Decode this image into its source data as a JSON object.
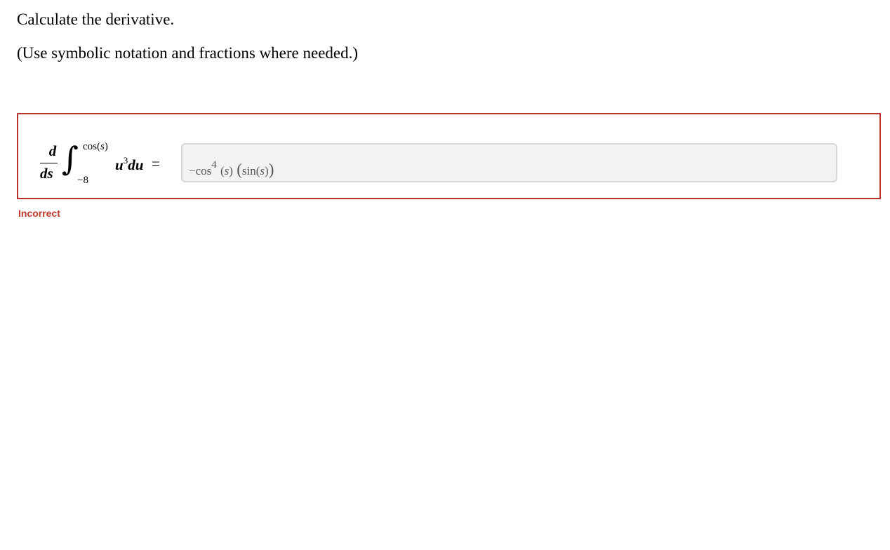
{
  "question": {
    "title": "Calculate the derivative.",
    "instructions": "(Use symbolic notation and fractions where needed.)"
  },
  "expression": {
    "numerator": "d",
    "denominator": "ds",
    "integral_symbol": "∫",
    "upper_limit_func": "cos",
    "upper_limit_var": "s",
    "lower_limit": "−8",
    "integrand_base": "u",
    "integrand_exponent": "3",
    "differential": "du",
    "equals": "="
  },
  "answer": {
    "neg": "−cos",
    "exponent": "4",
    "arg1": "s",
    "func2": "sin",
    "arg2": "s"
  },
  "feedback": {
    "status": "Incorrect",
    "status_color": "#c0392b",
    "border_color": "#b8322c"
  }
}
